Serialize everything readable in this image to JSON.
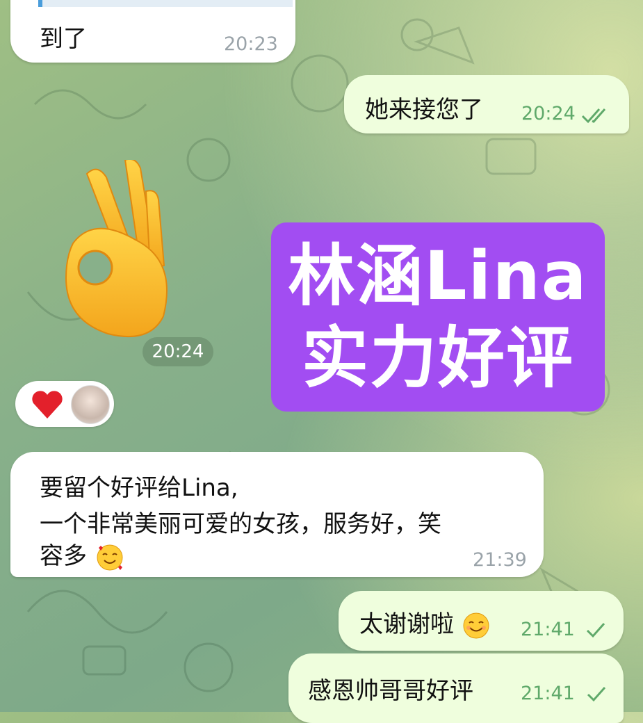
{
  "messages": [
    {
      "text": "到了",
      "time": "20:23",
      "direction": "incoming"
    },
    {
      "text": "她来接您了",
      "time": "20:24",
      "direction": "outgoing",
      "status": "read"
    },
    {
      "sticker": "ok-hand-emoji",
      "time": "20:24",
      "direction": "incoming"
    },
    {
      "text_lines": [
        "要留个好评给Lina,",
        "一个非常美丽可爱的女孩，服务好，笑",
        "容多"
      ],
      "emoji": "smiling-face-with-hearts",
      "time": "21:39",
      "direction": "incoming"
    },
    {
      "text": "太谢谢啦",
      "emoji": "smiling-face",
      "time": "21:41",
      "direction": "outgoing",
      "status": "sent"
    },
    {
      "text": "感恩帅哥哥好评",
      "time": "21:41",
      "direction": "outgoing",
      "status": "sent"
    }
  ],
  "reaction": {
    "emoji": "red-heart",
    "avatar": "user-avatar"
  },
  "overlay": {
    "line1": "林涵Lina",
    "line2": "实力好评",
    "color": "#a24df2"
  },
  "colors": {
    "incoming_bubble": "#ffffff",
    "outgoing_bubble": "#effedd",
    "read_check": "#5fa96a"
  }
}
